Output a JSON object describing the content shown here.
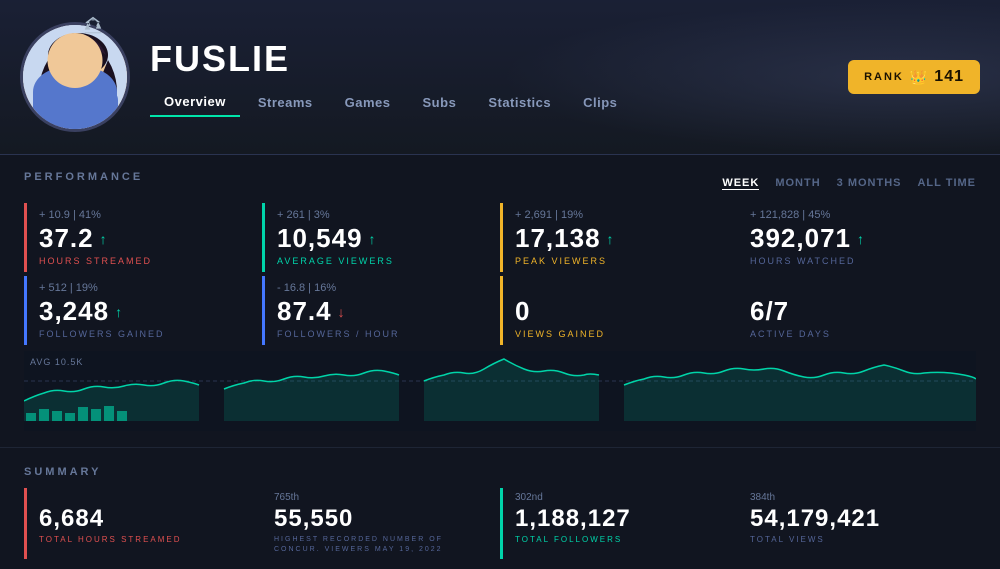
{
  "header": {
    "scale_icon": "⚖",
    "streamer_name": "FUSLIE",
    "rank_label": "RANK",
    "rank_crown": "👑",
    "rank_number": "141",
    "nav": {
      "tabs": [
        {
          "id": "overview",
          "label": "Overview",
          "active": true
        },
        {
          "id": "streams",
          "label": "Streams",
          "active": false
        },
        {
          "id": "games",
          "label": "Games",
          "active": false
        },
        {
          "id": "subs",
          "label": "Subs",
          "active": false
        },
        {
          "id": "statistics",
          "label": "Statistics",
          "active": false
        },
        {
          "id": "clips",
          "label": "Clips",
          "active": false
        }
      ]
    }
  },
  "performance": {
    "section_label": "PERFORMANCE",
    "time_filters": [
      {
        "id": "week",
        "label": "WEEK",
        "active": true
      },
      {
        "id": "month",
        "label": "MONTH",
        "active": false
      },
      {
        "id": "3months",
        "label": "3 MONTHS",
        "active": false
      },
      {
        "id": "alltime",
        "label": "ALL TIME",
        "active": false
      }
    ],
    "stats_row1": [
      {
        "id": "hours-streamed",
        "change": "+ 10.9 | 41%",
        "value": "37.2",
        "arrow": "up",
        "label": "HOURS STREAMED",
        "color": "red"
      },
      {
        "id": "avg-viewers",
        "change": "+ 261 | 3%",
        "value": "10,549",
        "arrow": "up",
        "label": "AVERAGE VIEWERS",
        "color": "teal"
      },
      {
        "id": "peak-viewers",
        "change": "+ 2,691 | 19%",
        "value": "17,138",
        "arrow": "up",
        "label": "PEAK VIEWERS",
        "color": "yellow"
      },
      {
        "id": "hours-watched",
        "change": "+ 121,828 | 45%",
        "value": "392,071",
        "arrow": "up",
        "label": "HOURS WATCHED",
        "color": "none"
      }
    ],
    "stats_row2": [
      {
        "id": "followers-gained",
        "change": "+ 512 | 19%",
        "value": "3,248",
        "arrow": "up",
        "label": "FOLLOWERS GAINED",
        "color": "blue"
      },
      {
        "id": "followers-hour",
        "change": "- 16.8 | 16%",
        "value": "87.4",
        "arrow": "down",
        "label": "FOLLOWERS / HOUR",
        "color": "blue"
      },
      {
        "id": "views-gained",
        "change": "",
        "value": "0",
        "arrow": "none",
        "label": "VIEWS GAINED",
        "color": "yellow"
      },
      {
        "id": "active-days",
        "change": "",
        "value": "6/7",
        "arrow": "none",
        "label": "ACTIVE DAYS",
        "color": "none"
      }
    ],
    "chart": {
      "avg_label": "AVG 10.5K"
    }
  },
  "summary": {
    "section_label": "SUMMARY",
    "items": [
      {
        "id": "total-hours",
        "rank": "",
        "value": "6,684",
        "label": "TOTAL HOURS STREAMED",
        "color": "red"
      },
      {
        "id": "highest-viewers",
        "rank": "765th",
        "value": "55,550",
        "label": "HIGHEST RECORDED NUMBER OF CONCUR. VIEWERS MAY 19, 2022",
        "color": "none"
      },
      {
        "id": "total-followers",
        "rank": "302nd",
        "value": "1,188,127",
        "label": "TOTAL FOLLOWERS",
        "color": "teal"
      },
      {
        "id": "total-views",
        "rank": "384th",
        "value": "54,179,421",
        "label": "TOTAL VIEWS",
        "color": "none"
      }
    ]
  }
}
